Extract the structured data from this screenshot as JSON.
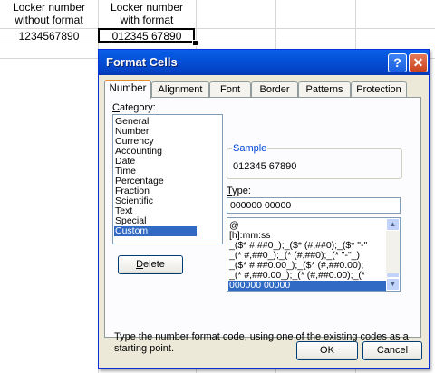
{
  "sheet": {
    "header_col1": [
      "Locker number",
      "without format"
    ],
    "header_col2": [
      "Locker number",
      "with format"
    ],
    "value_col1": "1234567890",
    "value_col2": "012345 67890"
  },
  "dialog": {
    "title": "Format Cells",
    "help_label": "?",
    "close_label": "✕",
    "tabs": [
      "Number",
      "Alignment",
      "Font",
      "Border",
      "Patterns",
      "Protection"
    ],
    "active_tab": "Number",
    "category_label_prefix": "C",
    "category_label_rest": "ategory:",
    "categories": [
      "General",
      "Number",
      "Currency",
      "Accounting",
      "Date",
      "Time",
      "Percentage",
      "Fraction",
      "Scientific",
      "Text",
      "Special",
      "Custom"
    ],
    "selected_category": "Custom",
    "sample_label": "Sample",
    "sample_value": "012345 67890",
    "type_label_prefix": "T",
    "type_label_rest": "ype:",
    "type_value": "000000 00000",
    "type_list": [
      "@",
      "[h]:mm:ss",
      "_($* #,##0_);_($* (#,##0);_($* \"-\"",
      "_(* #,##0_);_(* (#,##0);_(* \"-\"_)",
      "_($* #,##0.00_);_($* (#,##0.00);",
      "_(* #,##0.00_);_(* (#,##0.00);_(*",
      "000000 00000"
    ],
    "selected_type": "000000 00000",
    "delete_label_prefix": "D",
    "delete_label_rest": "elete",
    "description": "Type the number format code, using one of the existing codes as a starting point.",
    "ok_label": "OK",
    "cancel_label": "Cancel"
  }
}
